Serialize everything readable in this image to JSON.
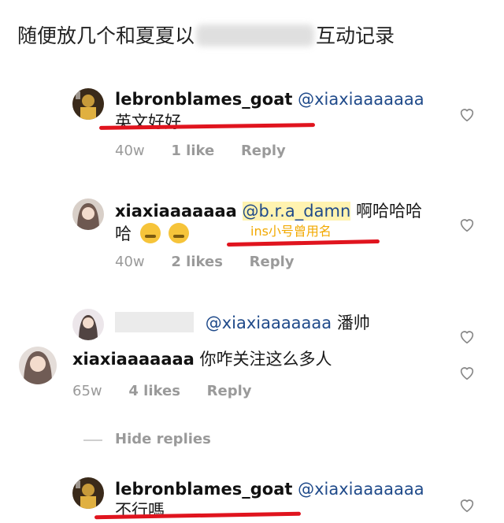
{
  "header": {
    "title_before": "随便放几个和夏夏以",
    "title_after": "互动记录"
  },
  "comments": [
    {
      "user": "lebronblames_goat",
      "mention": "@xiaxiaaaaaaa",
      "text": "英文好好",
      "age": "40w",
      "likes": "1 like",
      "reply": "Reply"
    },
    {
      "user": "xiaxiaaaaaaa",
      "mention": "@b.r.a_damn",
      "text_line1": "啊哈哈哈",
      "text_line2": "哈",
      "annotation": "ins小号曾用名",
      "age": "40w",
      "likes": "2 likes",
      "reply": "Reply"
    },
    {
      "mention": "@xiaxiaaaaaaa",
      "text": "潘帅"
    },
    {
      "user": "xiaxiaaaaaaa",
      "text": "你咋关注这么多人",
      "age": "65w",
      "likes": "4 likes",
      "reply": "Reply"
    },
    {
      "user": "lebronblames_goat",
      "mention": "@xiaxiaaaaaaa",
      "text": "不行嗎"
    }
  ],
  "hide_replies": "Hide replies",
  "colors": {
    "mention": "#1f4a8a",
    "underline": "#e0141e",
    "annotation": "#f2a900",
    "meta": "#9a9a9a"
  }
}
